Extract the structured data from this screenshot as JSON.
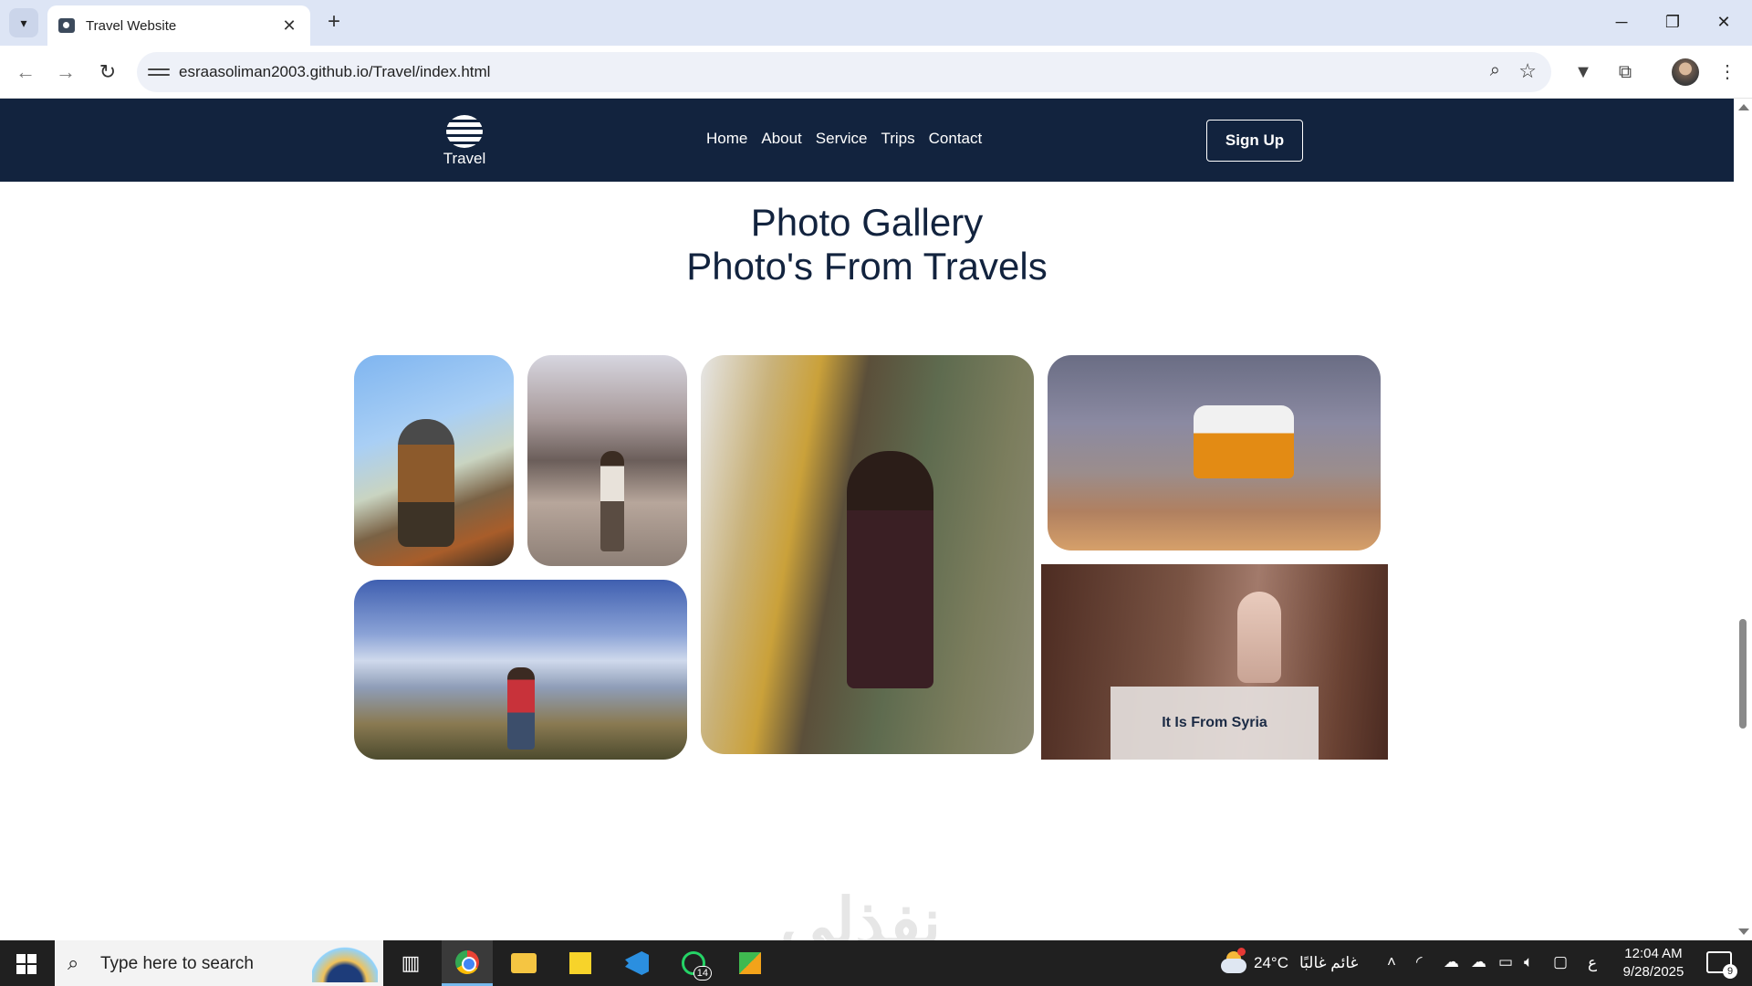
{
  "browser": {
    "tab_title": "Travel Website",
    "url": "esraasoliman2003.github.io/Travel/index.html",
    "new_tab_symbol": "+",
    "close_symbol": "✕"
  },
  "site": {
    "logo_text": "Travel",
    "nav": [
      "Home",
      "About",
      "Service",
      "Trips",
      "Contact"
    ],
    "signup_label": "Sign Up"
  },
  "gallery": {
    "title_line1": "Photo Gallery",
    "title_line2": "Photo's From Travels",
    "photos": [
      {
        "subject": "hiker with backpack under blue sky"
      },
      {
        "subject": "woman walking in city square"
      },
      {
        "subject": "woman leaning out of yellow van in forest"
      },
      {
        "subject": "orange camper van on rocky ground"
      },
      {
        "subject": "hiker with raised arms above clouds"
      },
      {
        "subject": "hand touching carved stone"
      }
    ],
    "caption": "It Is From Syria"
  },
  "watermark": "نفذلي",
  "taskbar": {
    "search_placeholder": "Type here to search",
    "whatsapp_badge": "14",
    "weather_temp": "24°C",
    "weather_desc": "غائم غالبًا",
    "input_lang": "ع",
    "time": "12:04 AM",
    "date": "9/28/2025",
    "notification_count": "9"
  }
}
